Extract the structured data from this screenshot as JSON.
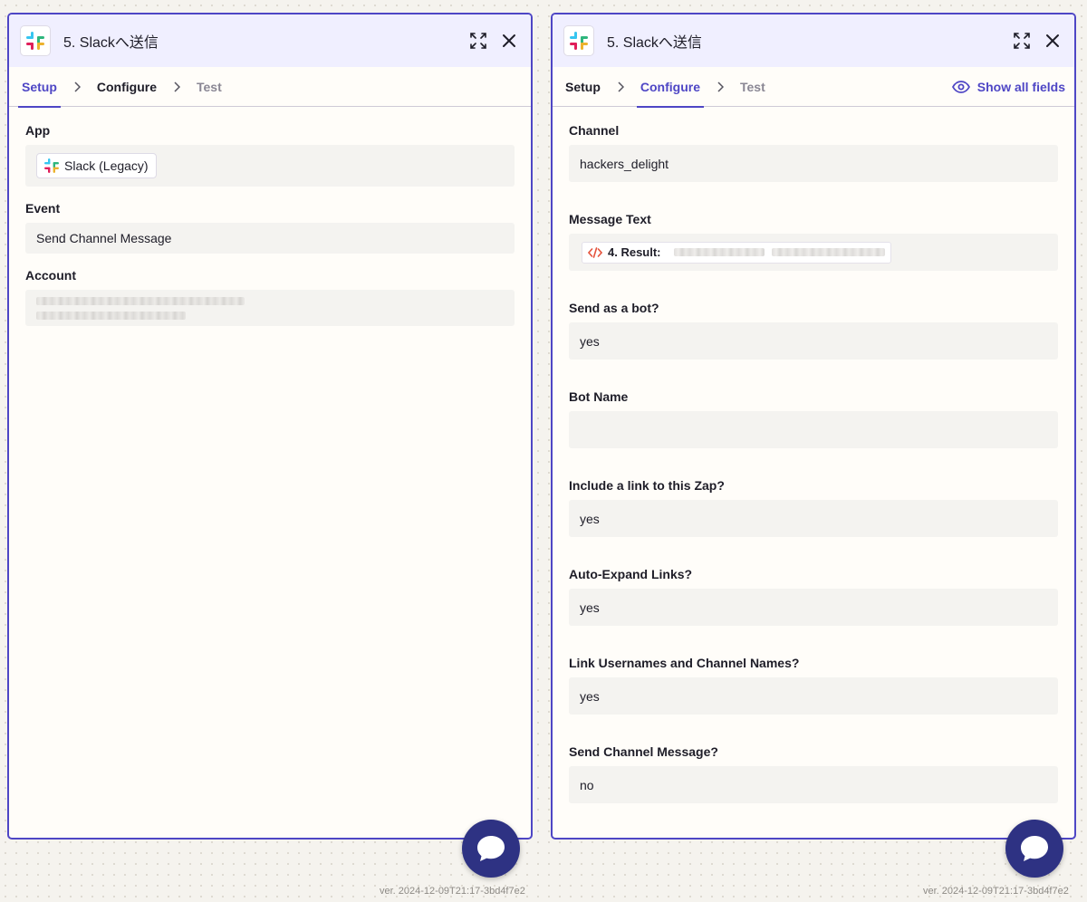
{
  "left_panel": {
    "title": "5. Slackへ送信",
    "tabs": [
      {
        "label": "Setup",
        "state": "active"
      },
      {
        "label": "Configure",
        "state": "done"
      },
      {
        "label": "Test",
        "state": "muted"
      }
    ],
    "fields": {
      "app": {
        "label": "App",
        "value": "Slack (Legacy)"
      },
      "event": {
        "label": "Event",
        "value": "Send Channel Message"
      },
      "account": {
        "label": "Account"
      }
    }
  },
  "right_panel": {
    "title": "5. Slackへ送信",
    "tabs": [
      {
        "label": "Setup",
        "state": "done"
      },
      {
        "label": "Configure",
        "state": "active"
      },
      {
        "label": "Test",
        "state": "muted"
      }
    ],
    "show_all_fields": "Show all fields",
    "fields": [
      {
        "label": "Channel",
        "value": "hackers_delight"
      },
      {
        "label": "Message Text",
        "pill": "4. Result:"
      },
      {
        "label": "Send as a bot?",
        "value": "yes"
      },
      {
        "label": "Bot Name",
        "value": ""
      },
      {
        "label": "Include a link to this Zap?",
        "value": "yes"
      },
      {
        "label": "Auto-Expand Links?",
        "value": "yes"
      },
      {
        "label": "Link Usernames and Channel Names?",
        "value": "yes"
      },
      {
        "label": "Send Channel Message?",
        "value": "no"
      }
    ]
  },
  "version_left": "ver. 2024-12-09T21:17-3bd4f7e2",
  "version_right": "ver. 2024-12-09T21:17-3bd4f7e2",
  "icons": {
    "app": "slack-icon",
    "expand": "expand-icon",
    "close": "close-icon",
    "chevron": "chevron-right-icon",
    "eye": "eye-icon",
    "code": "code-icon",
    "chat": "chat-bubble-icon"
  },
  "colors": {
    "accent": "#4e46c5",
    "header_bg": "#f0efff",
    "chat_button": "#2e3283",
    "code_icon": "#e5533d"
  }
}
